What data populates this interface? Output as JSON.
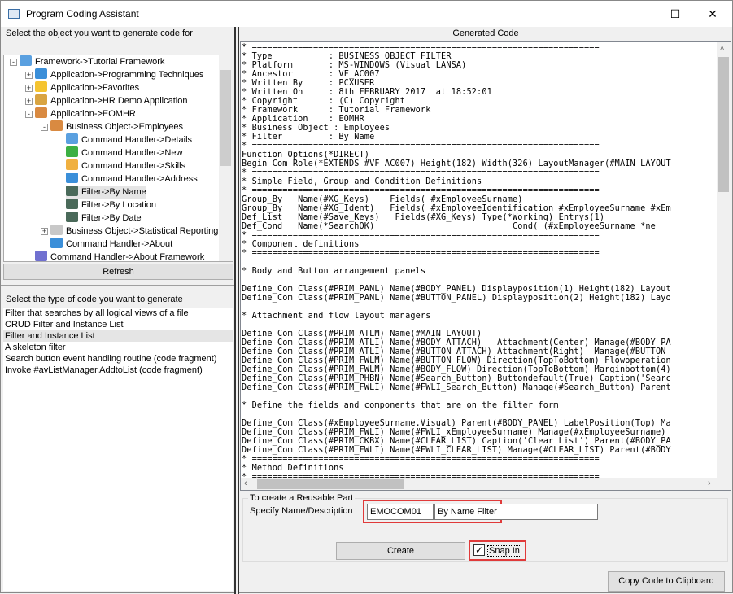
{
  "window": {
    "title": "Program Coding Assistant",
    "minimize": "—",
    "maximize": "☐",
    "close": "✕"
  },
  "left": {
    "object_prompt": "Select the object you want to generate code for",
    "tree": [
      {
        "label": "Framework->Tutorial Framework",
        "icon": "window-icon",
        "color": "#5aa0e0"
      },
      {
        "label": "Application->Programming Techniques",
        "icon": "gear-icon",
        "color": "#3b8fd9"
      },
      {
        "label": "Application->Favorites",
        "icon": "star-icon",
        "color": "#f5c430"
      },
      {
        "label": "Application->HR Demo Application",
        "icon": "user-icon",
        "color": "#d9a441"
      },
      {
        "label": "Application->EOMHR",
        "icon": "users-icon",
        "color": "#d98a41"
      },
      {
        "label": "Business Object->Employees",
        "icon": "users-icon",
        "color": "#d98a41"
      },
      {
        "label": "Command Handler->Details",
        "icon": "window-icon",
        "color": "#5aa0e0"
      },
      {
        "label": "Command Handler->New",
        "icon": "plus-circle-icon",
        "color": "#3cb043"
      },
      {
        "label": "Command Handler->Skills",
        "icon": "hand-icon",
        "color": "#f0b040"
      },
      {
        "label": "Command Handler->Address",
        "icon": "envelope-icon",
        "color": "#3b8fd9"
      },
      {
        "label": "Filter->By Name",
        "icon": "filter-icon",
        "color": "#4a6a5a"
      },
      {
        "label": "Filter->By Location",
        "icon": "filter-icon",
        "color": "#4a6a5a"
      },
      {
        "label": "Filter->By Date",
        "icon": "filter-icon",
        "color": "#4a6a5a"
      },
      {
        "label": "Business Object->Statistical Reporting",
        "icon": "document-icon",
        "color": "#c8c8c8"
      },
      {
        "label": "Command Handler->About",
        "icon": "documents-icon",
        "color": "#3b8fd9"
      },
      {
        "label": "Command Handler->About Framework",
        "icon": "gear-icon",
        "color": "#7070d0"
      }
    ],
    "refresh_label": "Refresh",
    "type_prompt": "Select the type of code you want to generate",
    "types": [
      "Filter that searches by all logical views of a file",
      "CRUD Filter and Instance List",
      "Filter and Instance List",
      "A skeleton filter",
      "Search button event handling routine (code fragment)",
      "Invoke #avListManager.AddtoList (code fragment)"
    ]
  },
  "right": {
    "header": "Generated Code",
    "code": "* ====================================================================\n* Type           : BUSINESS OBJECT FILTER\n* Platform       : MS-WINDOWS (Visual LANSA)\n* Ancestor       : VF_AC007\n* Written By     : PCXUSER\n* Written On     : 8th FEBRUARY 2017  at 18:52:01\n* Copyright      : (C) Copyright\n* Framework      : Tutorial Framework\n* Application    : EOMHR\n* Business Object : Employees\n* Filter         : By Name\n* ====================================================================\nFunction Options(*DIRECT)\nBegin_Com Role(*EXTENDS #VF_AC007) Height(182) Width(326) LayoutManager(#MAIN_LAYOUT\n* ====================================================================\n* Simple Field, Group and Condition Definitions\n* ====================================================================\nGroup_By   Name(#XG_Keys)    Fields( #xEmployeeSurname)\nGroup_By   Name(#XG_Ident)   Fields( #xEmployeeIdentification #xEmployeeSurname #xEm\nDef_List   Name(#Save_Keys)   Fields(#XG_Keys) Type(*Working) Entrys(1)\nDef_Cond   Name(*SearchOK)                           Cond( (#xEmployeeSurname *ne\n* ====================================================================\n* Component definitions\n* ====================================================================\n\n* Body and Button arrangement panels\n\nDefine_Com Class(#PRIM_PANL) Name(#BODY_PANEL) Displayposition(1) Height(182) Layout\nDefine_Com Class(#PRIM_PANL) Name(#BUTTON_PANEL) Displayposition(2) Height(182) Layo\n\n* Attachment and flow layout managers\n\nDefine_Com Class(#PRIM_ATLM) Name(#MAIN_LAYOUT)\nDefine_Com Class(#PRIM_ATLI) Name(#BODY_ATTACH)   Attachment(Center) Manage(#BODY_PA\nDefine_Com Class(#PRIM_ATLI) Name(#BUTTON_ATTACH) Attachment(Right)  Manage(#BUTTON_\nDefine_Com Class(#PRIM_FWLM) Name(#BUTTON_FLOW) Direction(TopToBottom) Flowoperation\nDefine_Com Class(#PRIM_FWLM) Name(#BODY_FLOW) Direction(TopToBottom) Marginbottom(4)\nDefine_Com Class(#PRIM_PHBN) Name(#Search_Button) Buttondefault(True) Caption('Searc\nDefine_Com Class(#PRIM_FWLI) Name(#FWLI_Search_Button) Manage(#Search_Button) Parent\n\n* Define the fields and components that are on the filter form\n\nDefine_Com Class(#xEmployeeSurname.Visual) Parent(#BODY_PANEL) LabelPosition(Top) Ma\nDefine_Com Class(#PRIM_FWLI) Name(#FWLI_xEmployeeSurname) Manage(#xEmployeeSurname) \nDefine_Com Class(#PRIM_CKBX) Name(#CLEAR_LIST) Caption('Clear List') Parent(#BODY_PA\nDefine_Com Class(#PRIM_FWLI) Name(#FWLI_CLEAR_LIST) Manage(#CLEAR_LIST) Parent(#BODY\n* ====================================================================\n* Method Definitions\n* ====================================================================",
    "reusable": {
      "legend": "To create a Reusable Part",
      "label": "Specify Name/Description",
      "name_value": "EMOCOM01",
      "desc_value": "By Name Filter",
      "create_label": "Create",
      "snap_in_label": "Snap In",
      "snap_in_checked": true
    },
    "copy_label": "Copy Code to Clipboard"
  }
}
